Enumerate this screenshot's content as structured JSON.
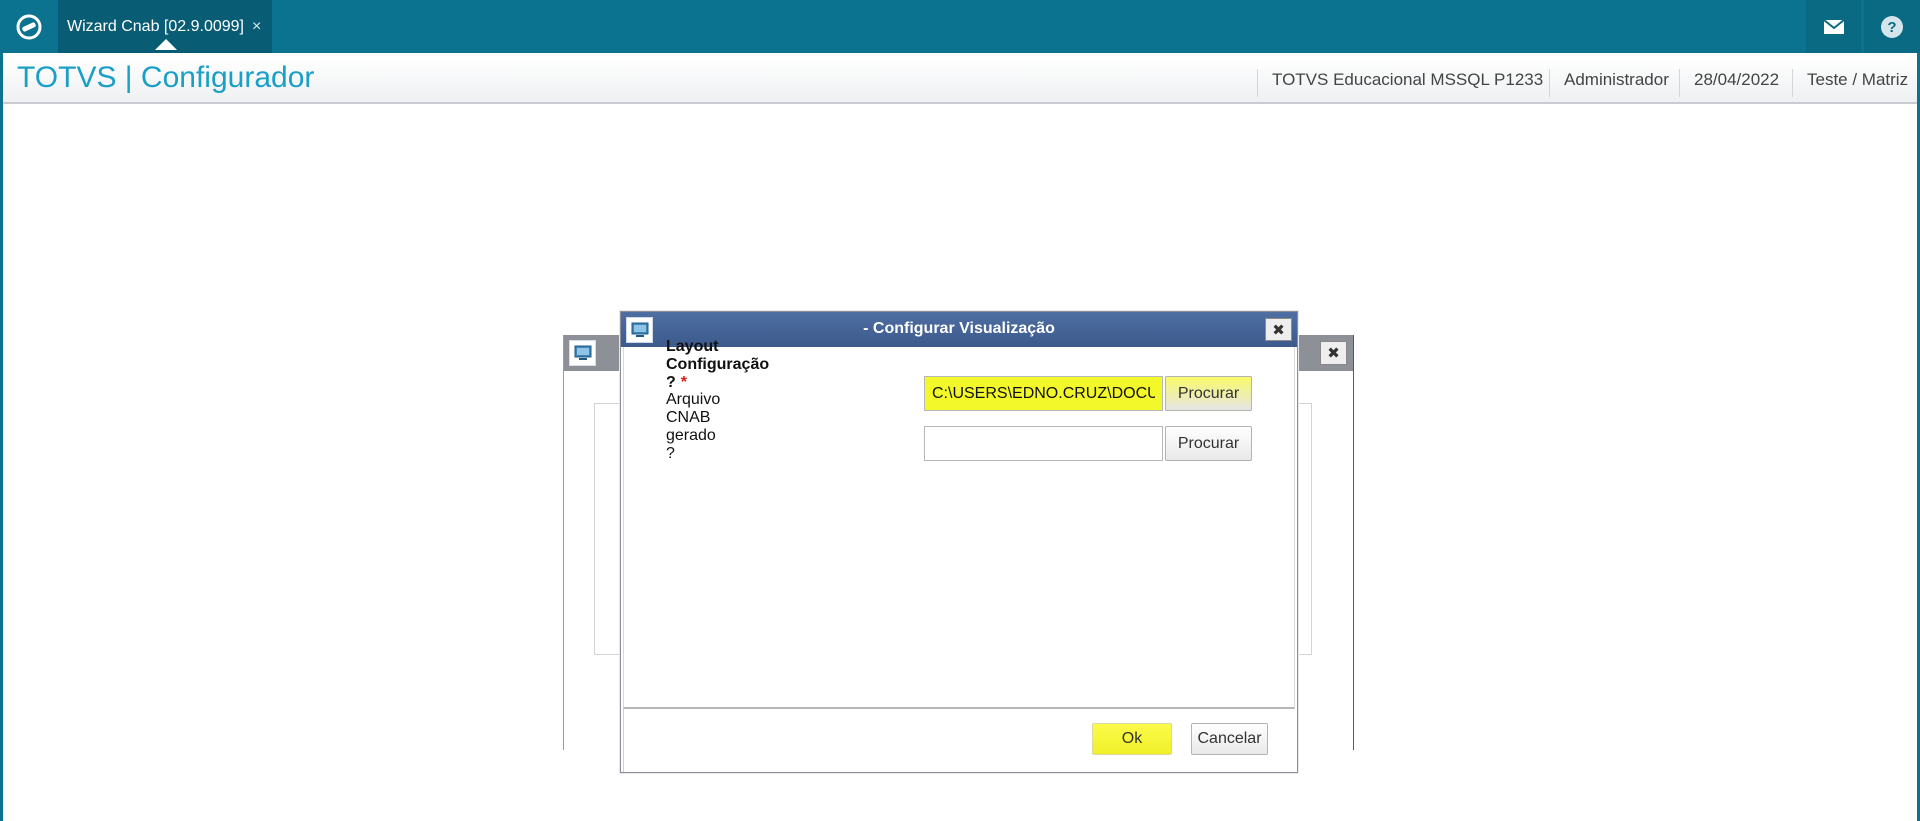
{
  "topbar": {
    "logo_icon": "totvs-logo-icon",
    "tab_label": "Wizard Cnab [02.9.0099]",
    "tab_close": "×",
    "mail_icon": "mail-icon",
    "help_icon": "help-icon",
    "bar_color": "#0b728f"
  },
  "header": {
    "title": "TOTVS | Configurador",
    "system": "TOTVS Educacional MSSQL P1233",
    "user": "Administrador",
    "date": "28/04/2022",
    "branch": "Teste / Matriz",
    "title_color": "#1a9fc7"
  },
  "modal": {
    "title": "- Configurar Visualização",
    "titlebar_color": "#4a6798",
    "fields": {
      "layout_label": "Layout Configuração ?",
      "layout_required": "*",
      "layout_value": "C:\\USERS\\EDNO.CRUZ\\DOCU",
      "cnab_label": "Arquivo CNAB gerado ?",
      "cnab_value": ""
    },
    "browse_label": "Procurar",
    "ok_label": "Ok",
    "cancel_label": "Cancelar"
  }
}
